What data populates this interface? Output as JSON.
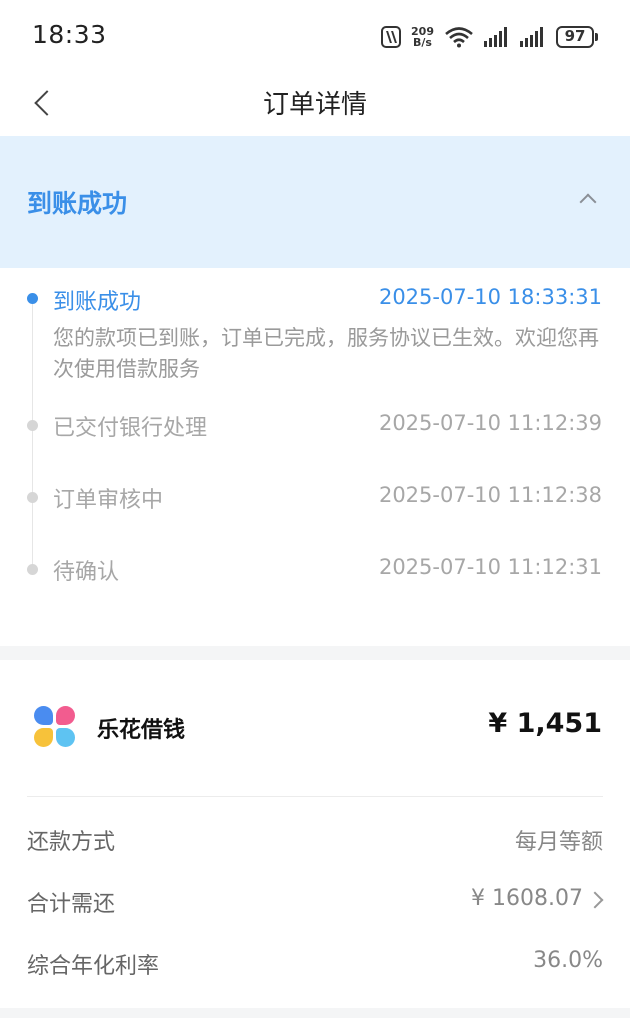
{
  "status_bar": {
    "time": "18:33",
    "speed_value": "209",
    "speed_unit": "B/s",
    "battery": "97",
    "icons": [
      "nfc-icon",
      "wifi-icon",
      "signal-icon",
      "signal-icon",
      "battery-icon"
    ]
  },
  "nav": {
    "title": "订单详情",
    "back_icon": "chevron-left-icon"
  },
  "banner": {
    "title": "到账成功",
    "collapse_icon": "chevron-up-icon",
    "background": "#e3f1fd",
    "accent": "#3a8fe8"
  },
  "timeline": [
    {
      "label": "到账成功",
      "time": "2025-07-10 18:33:31",
      "desc": "您的款项已到账，订单已完成，服务协议已生效。欢迎您再次使用借款服务",
      "active": true
    },
    {
      "label": "已交付银行处理",
      "time": "2025-07-10 11:12:39",
      "active": false
    },
    {
      "label": "订单审核中",
      "time": "2025-07-10 11:12:38",
      "active": false
    },
    {
      "label": "待确认",
      "time": "2025-07-10 11:12:31",
      "active": false
    }
  ],
  "loan": {
    "brand": "乐花借钱",
    "amount": "¥ 1,451",
    "rows": [
      {
        "label": "还款方式",
        "value": "每月等额"
      },
      {
        "label": "合计需还",
        "value": "¥ 1608.07"
      },
      {
        "label": "综合年化利率",
        "value": "36.0%"
      }
    ]
  }
}
